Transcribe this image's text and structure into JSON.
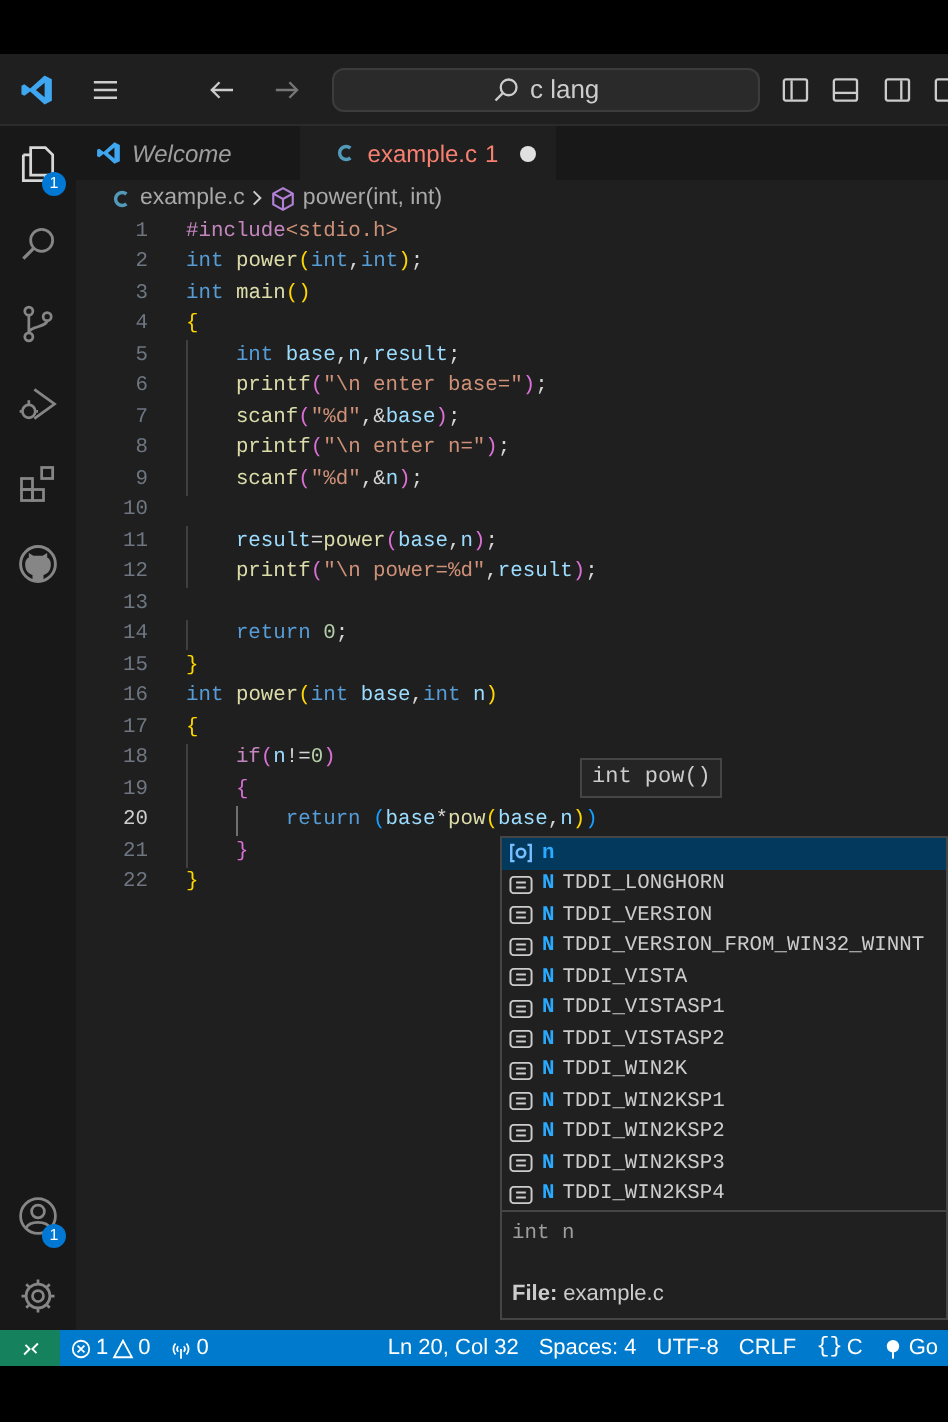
{
  "title_bar": {
    "search": "c lang"
  },
  "activity_bar": {
    "top": [
      {
        "kind": "explorer",
        "badge": "1"
      },
      {
        "kind": "search"
      },
      {
        "kind": "source-control"
      },
      {
        "kind": "run-debug"
      },
      {
        "kind": "extensions"
      },
      {
        "kind": "github"
      }
    ],
    "bottom": [
      {
        "kind": "account",
        "badge": "1"
      },
      {
        "kind": "settings"
      }
    ]
  },
  "tabs": [
    {
      "kind": "welcome",
      "label": "Welcome",
      "selected": false
    },
    {
      "kind": "c",
      "label": "example.c",
      "problems": "1",
      "selected": true,
      "modified": true
    }
  ],
  "breadcrumb": [
    {
      "kind": "c",
      "label": "example.c"
    },
    {
      "kind": "function",
      "label": "power(int, int)"
    }
  ],
  "code": {
    "lines": [
      {
        "num": "1",
        "current": false,
        "tokens": [
          {
            "kind": "pp",
            "t": "#include"
          },
          {
            "kind": "inc",
            "t": "<stdio.h>"
          }
        ]
      },
      {
        "num": "2",
        "current": false,
        "tokens": [
          {
            "kind": "kw",
            "t": "int"
          },
          {
            "kind": "fn",
            "t": " power"
          },
          {
            "kind": "b1",
            "t": "("
          },
          {
            "kind": "kw",
            "t": "int"
          },
          {
            "kind": "p",
            "t": ","
          },
          {
            "kind": "kw",
            "t": "int"
          },
          {
            "kind": "b1",
            "t": ")"
          },
          {
            "kind": "p",
            "t": ";"
          }
        ]
      },
      {
        "num": "3",
        "current": false,
        "tokens": [
          {
            "kind": "kw",
            "t": "int"
          },
          {
            "kind": "fn",
            "t": " main"
          },
          {
            "kind": "b1",
            "t": "()"
          }
        ]
      },
      {
        "num": "4",
        "current": false,
        "tokens": [
          {
            "kind": "b1",
            "t": "{"
          }
        ]
      },
      {
        "num": "5",
        "current": false,
        "tokens": [
          {
            "kind": "kw",
            "t": "    int"
          },
          {
            "kind": "var",
            "t": " base"
          },
          {
            "kind": "p",
            "t": ","
          },
          {
            "kind": "var",
            "t": "n"
          },
          {
            "kind": "p",
            "t": ","
          },
          {
            "kind": "var",
            "t": "result"
          },
          {
            "kind": "p",
            "t": ";"
          }
        ]
      },
      {
        "num": "6",
        "current": false,
        "tokens": [
          {
            "kind": "fn",
            "t": "    printf"
          },
          {
            "kind": "b2",
            "t": "("
          },
          {
            "kind": "str",
            "t": "\"\\n enter base=\""
          },
          {
            "kind": "b2",
            "t": ")"
          },
          {
            "kind": "p",
            "t": ";"
          }
        ]
      },
      {
        "num": "7",
        "current": false,
        "tokens": [
          {
            "kind": "fn",
            "t": "    scanf"
          },
          {
            "kind": "b2",
            "t": "("
          },
          {
            "kind": "str",
            "t": "\"%d\""
          },
          {
            "kind": "p",
            "t": ",&"
          },
          {
            "kind": "var",
            "t": "base"
          },
          {
            "kind": "b2",
            "t": ")"
          },
          {
            "kind": "p",
            "t": ";"
          }
        ]
      },
      {
        "num": "8",
        "current": false,
        "tokens": [
          {
            "kind": "fn",
            "t": "    printf"
          },
          {
            "kind": "b2",
            "t": "("
          },
          {
            "kind": "str",
            "t": "\"\\n enter n=\""
          },
          {
            "kind": "b2",
            "t": ")"
          },
          {
            "kind": "p",
            "t": ";"
          }
        ]
      },
      {
        "num": "9",
        "current": false,
        "tokens": [
          {
            "kind": "fn",
            "t": "    scanf"
          },
          {
            "kind": "b2",
            "t": "("
          },
          {
            "kind": "str",
            "t": "\"%d\""
          },
          {
            "kind": "p",
            "t": ",&"
          },
          {
            "kind": "var",
            "t": "n"
          },
          {
            "kind": "b2",
            "t": ")"
          },
          {
            "kind": "p",
            "t": ";"
          }
        ]
      },
      {
        "num": "10",
        "current": false
      },
      {
        "num": "11",
        "current": false,
        "tokens": [
          {
            "kind": "var",
            "t": "    result"
          },
          {
            "kind": "p",
            "t": "="
          },
          {
            "kind": "fn",
            "t": "power"
          },
          {
            "kind": "b2",
            "t": "("
          },
          {
            "kind": "var",
            "t": "base"
          },
          {
            "kind": "p",
            "t": ","
          },
          {
            "kind": "var",
            "t": "n"
          },
          {
            "kind": "b2",
            "t": ")"
          },
          {
            "kind": "p",
            "t": ";"
          }
        ]
      },
      {
        "num": "12",
        "current": false,
        "tokens": [
          {
            "kind": "fn",
            "t": "    printf"
          },
          {
            "kind": "b2",
            "t": "("
          },
          {
            "kind": "str",
            "t": "\"\\n power=%d\""
          },
          {
            "kind": "p",
            "t": ","
          },
          {
            "kind": "var",
            "t": "result"
          },
          {
            "kind": "b2",
            "t": ")"
          },
          {
            "kind": "p",
            "t": ";"
          }
        ]
      },
      {
        "num": "13",
        "current": false
      },
      {
        "num": "14",
        "current": false,
        "tokens": [
          {
            "kind": "kw",
            "t": "    return"
          },
          {
            "kind": "num",
            "t": " 0"
          },
          {
            "kind": "p",
            "t": ";"
          }
        ]
      },
      {
        "num": "15",
        "current": false,
        "tokens": [
          {
            "kind": "b1",
            "t": "}"
          }
        ]
      },
      {
        "num": "16",
        "current": false,
        "tokens": [
          {
            "kind": "kw",
            "t": "int"
          },
          {
            "kind": "fn",
            "t": " power"
          },
          {
            "kind": "b1",
            "t": "("
          },
          {
            "kind": "kw",
            "t": "int"
          },
          {
            "kind": "var",
            "t": " base"
          },
          {
            "kind": "p",
            "t": ","
          },
          {
            "kind": "kw",
            "t": "int"
          },
          {
            "kind": "var",
            "t": " n"
          },
          {
            "kind": "b1",
            "t": ")"
          }
        ]
      },
      {
        "num": "17",
        "current": false,
        "tokens": [
          {
            "kind": "b1",
            "t": "{"
          }
        ]
      },
      {
        "num": "18",
        "current": false,
        "tokens": [
          {
            "kind": "ctl",
            "t": "    if"
          },
          {
            "kind": "b2",
            "t": "("
          },
          {
            "kind": "var",
            "t": "n"
          },
          {
            "kind": "p",
            "t": "!="
          },
          {
            "kind": "num",
            "t": "0"
          },
          {
            "kind": "b2",
            "t": ")"
          }
        ]
      },
      {
        "num": "19",
        "current": false,
        "tokens": [
          {
            "kind": "b2",
            "t": "    {"
          }
        ]
      },
      {
        "num": "20",
        "current": true,
        "tokens": [
          {
            "kind": "kw",
            "t": "        return"
          },
          {
            "kind": "b3",
            "t": " ("
          },
          {
            "kind": "var",
            "t": "base"
          },
          {
            "kind": "p",
            "t": "*"
          },
          {
            "kind": "fn",
            "t": "pow"
          },
          {
            "kind": "b1",
            "t": "("
          },
          {
            "kind": "var",
            "t": "base"
          },
          {
            "kind": "p",
            "t": ","
          },
          {
            "kind": "var",
            "t": "n"
          },
          {
            "kind": "b1",
            "t": ")"
          },
          {
            "kind": "b3",
            "t": ")"
          }
        ]
      },
      {
        "num": "21",
        "current": false,
        "tokens": [
          {
            "kind": "b2",
            "t": "    }"
          }
        ]
      },
      {
        "num": "22",
        "current": false,
        "tokens": [
          {
            "kind": "b1",
            "t": "}"
          }
        ]
      }
    ]
  },
  "hover": {
    "text": "int pow()"
  },
  "suggest": {
    "items": [
      {
        "kind": "variable",
        "match": "n",
        "selected": true
      },
      {
        "kind": "constant",
        "match": "N",
        "text": "TDDI_LONGHORN",
        "selected": false
      },
      {
        "kind": "constant",
        "match": "N",
        "text": "TDDI_VERSION",
        "selected": false
      },
      {
        "kind": "constant",
        "match": "N",
        "text": "TDDI_VERSION_FROM_WIN32_WINNT",
        "selected": false
      },
      {
        "kind": "constant",
        "match": "N",
        "text": "TDDI_VISTA",
        "selected": false
      },
      {
        "kind": "constant",
        "match": "N",
        "text": "TDDI_VISTASP1",
        "selected": false
      },
      {
        "kind": "constant",
        "match": "N",
        "text": "TDDI_VISTASP2",
        "selected": false
      },
      {
        "kind": "constant",
        "match": "N",
        "text": "TDDI_WIN2K",
        "selected": false
      },
      {
        "kind": "constant",
        "match": "N",
        "text": "TDDI_WIN2KSP1",
        "selected": false
      },
      {
        "kind": "constant",
        "match": "N",
        "text": "TDDI_WIN2KSP2",
        "selected": false
      },
      {
        "kind": "constant",
        "match": "N",
        "text": "TDDI_WIN2KSP3",
        "selected": false
      },
      {
        "kind": "constant",
        "match": "N",
        "text": "TDDI_WIN2KSP4",
        "selected": false
      }
    ],
    "detail": "int n",
    "file": "**File:** example.c"
  },
  "status_bar": {
    "left": [
      {
        "kind": "remote"
      },
      {
        "kind": "problems",
        "errors": "1",
        "warnings": "0"
      },
      {
        "kind": "ports",
        "text": "0"
      }
    ],
    "right": [
      {
        "kind": "text",
        "text": "Ln 20, Col 32"
      },
      {
        "kind": "text",
        "text": "Spaces: 4"
      },
      {
        "kind": "text",
        "text": "UTF-8"
      },
      {
        "kind": "text",
        "text": "CRLF"
      },
      {
        "kind": "language",
        "icon": "{}",
        "text": "C"
      },
      {
        "kind": "live",
        "text": "Go"
      }
    ]
  }
}
